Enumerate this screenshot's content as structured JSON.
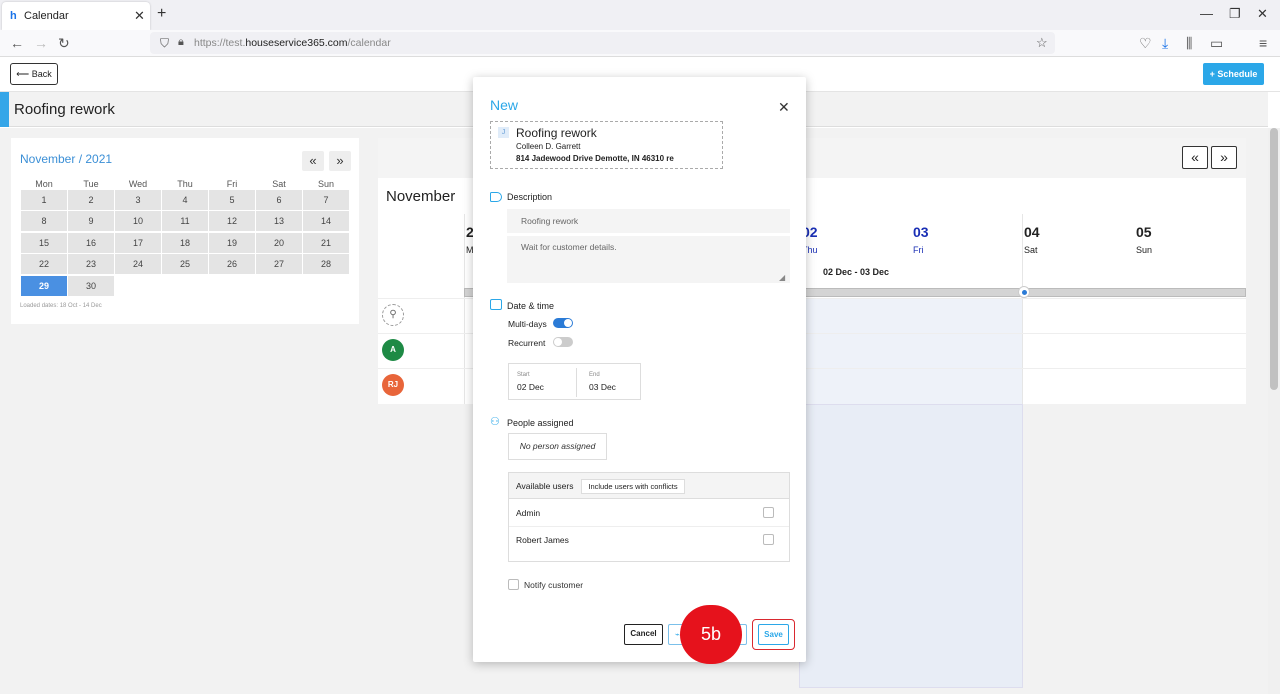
{
  "browser": {
    "tab_title": "Calendar",
    "url_prefix": "https://test.",
    "url_host": "houseservice365.com",
    "url_path": "/calendar"
  },
  "header": {
    "back_label": "Back",
    "schedule_label": "Schedule",
    "page_title": "Roofing rework"
  },
  "mini_calendar": {
    "title": "November / 2021",
    "weekdays": [
      "Mon",
      "Tue",
      "Wed",
      "Thu",
      "Fri",
      "Sat",
      "Sun"
    ],
    "days": [
      "1",
      "2",
      "3",
      "4",
      "5",
      "6",
      "7",
      "8",
      "9",
      "10",
      "11",
      "12",
      "13",
      "14",
      "15",
      "16",
      "17",
      "18",
      "19",
      "20",
      "21",
      "22",
      "23",
      "24",
      "25",
      "26",
      "27",
      "28",
      "29",
      "30"
    ],
    "selected_day": "29",
    "loaded_dates": "Loaded dates: 18 Oct - 14 Dec"
  },
  "calendar": {
    "month_label": "November",
    "days": [
      {
        "num": "2",
        "name": "M"
      },
      {
        "num": "02",
        "name": "Thu"
      },
      {
        "num": "03",
        "name": "Fri"
      },
      {
        "num": "04",
        "name": "Sat"
      },
      {
        "num": "05",
        "name": "Sun"
      }
    ],
    "range_label": "02 Dec - 03 Dec",
    "avatars": [
      {
        "initials": "A",
        "color": "#1e8a45"
      },
      {
        "initials": "RJ",
        "color": "#e8653a"
      }
    ]
  },
  "modal": {
    "title": "New",
    "job": {
      "icon_letter": "J",
      "title": "Roofing rework",
      "client": "Colleen D. Garrett",
      "address": "814 Jadewood Drive Demotte, IN 46310 re"
    },
    "description_label": "Description",
    "description_title": "Roofing rework",
    "description_notes": "Wait for customer details.",
    "datetime_label": "Date & time",
    "multidays_label": "Multi-days",
    "multidays_on": true,
    "recurrent_label": "Recurrent",
    "recurrent_on": false,
    "start_label": "Start",
    "start_value": "02 Dec",
    "end_label": "End",
    "end_value": "03 Dec",
    "people_label": "People assigned",
    "no_person": "No person assigned",
    "available_users_label": "Available users",
    "conflicts_button": "Include users with conflicts",
    "users": [
      "Admin",
      "Robert James"
    ],
    "notify_label": "Notify customer",
    "cancel_label": "Cancel",
    "mid_button_label": "h",
    "save_label": "Save"
  },
  "annotation": {
    "step_label": "5b",
    "color": "#e6121c"
  }
}
